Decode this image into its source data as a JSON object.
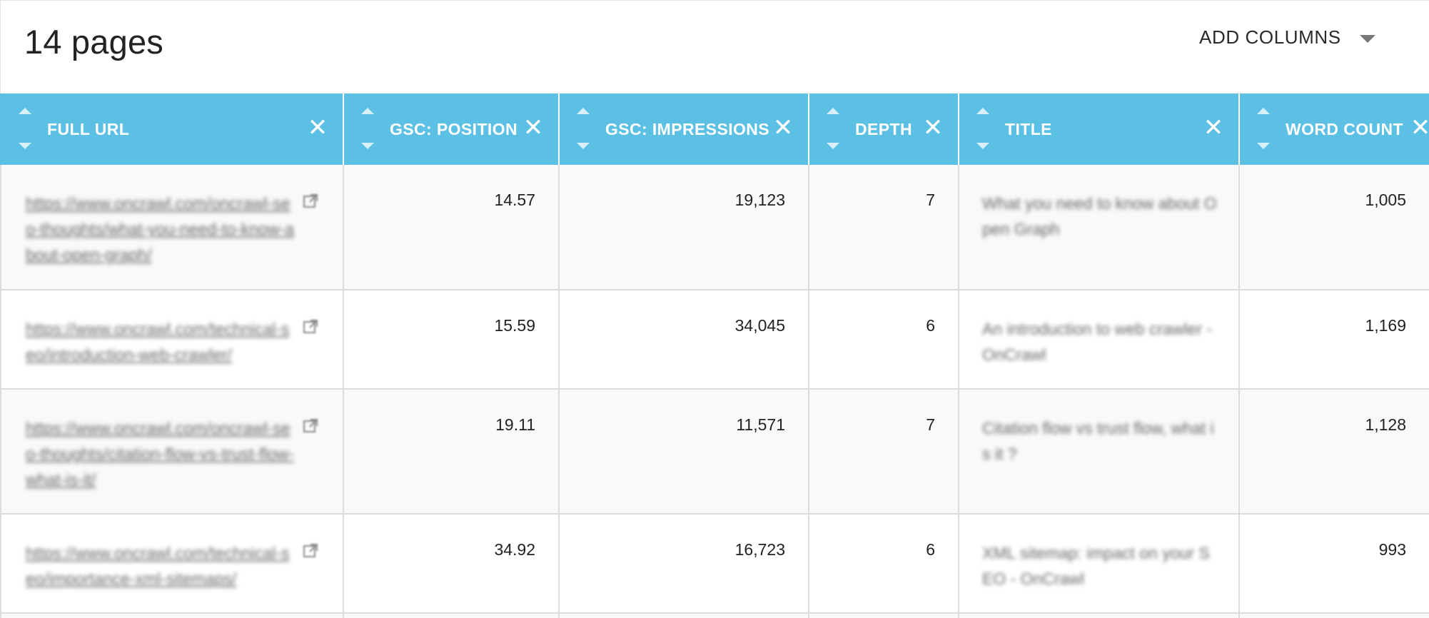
{
  "header": {
    "title": "14 pages",
    "add_columns_label": "ADD COLUMNS",
    "add_columns_icon": "caret-down-icon"
  },
  "colors": {
    "header_bg": "#5bc0e3",
    "header_text": "#ffffff",
    "row_alt_bg": "#f9f9f9",
    "grid_line": "#dcdcdc"
  },
  "columns": [
    {
      "label": "FULL URL",
      "sort_icon": "sort-arrows-icon",
      "close_icon": "close-icon"
    },
    {
      "label": "GSC: POSITION",
      "sort_icon": "sort-arrows-icon",
      "close_icon": "close-icon"
    },
    {
      "label": "GSC: IMPRESSIONS",
      "sort_icon": "sort-arrows-icon",
      "close_icon": "close-icon"
    },
    {
      "label": "DEPTH",
      "sort_icon": "sort-arrows-icon",
      "close_icon": "close-icon"
    },
    {
      "label": "TITLE",
      "sort_icon": "sort-arrows-icon",
      "close_icon": "close-icon"
    },
    {
      "label": "WORD COUNT",
      "sort_icon": "sort-arrows-icon",
      "close_icon": "close-icon"
    }
  ],
  "rows": [
    {
      "url": "https://www.oncrawl.com/oncrawl-seo-thoughts/what-you-need-to-know-about-open-graph/",
      "position": "14.57",
      "impressions": "19,123",
      "depth": "7",
      "title": "What you need to know about Open Graph",
      "word_count": "1,005"
    },
    {
      "url": "https://www.oncrawl.com/technical-seo/introduction-web-crawler/",
      "position": "15.59",
      "impressions": "34,045",
      "depth": "6",
      "title": "An introduction to web crawler - OnCrawl",
      "word_count": "1,169"
    },
    {
      "url": "https://www.oncrawl.com/oncrawl-seo-thoughts/citation-flow-vs-trust-flow-what-is-it/",
      "position": "19.11",
      "impressions": "11,571",
      "depth": "7",
      "title": "Citation flow vs trust flow, what is it ?",
      "word_count": "1,128"
    },
    {
      "url": "https://www.oncrawl.com/technical-seo/importance-xml-sitemaps/",
      "position": "34.92",
      "impressions": "16,723",
      "depth": "6",
      "title": "XML sitemap: impact on your SEO - OnCrawl",
      "word_count": "993"
    }
  ]
}
